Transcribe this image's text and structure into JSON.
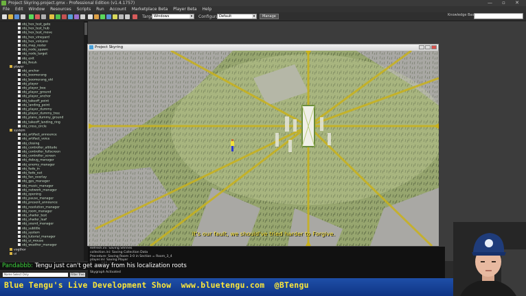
{
  "ide": {
    "title": "Project Skyring.project.gmx  -  Professional Edition (v1.4.1757)",
    "menu": [
      "File",
      "Edit",
      "Window",
      "Resources",
      "Scripts",
      "Run",
      "Account",
      "Marketplace Beta",
      "Player Beta",
      "Help"
    ],
    "toolbar": {
      "target_label": "Target:",
      "target_value": "Windows",
      "configuration_label": "Configuration:",
      "configuration_value": "Default",
      "manage_label": "Manage",
      "knowledge_label": "Knowledge Base:"
    }
  },
  "tree": {
    "items": [
      {
        "label": "obj_hex_test_gate",
        "kind": "item"
      },
      {
        "label": "obj_hex_test_hub",
        "kind": "item"
      },
      {
        "label": "obj_hex_test_move",
        "kind": "item"
      },
      {
        "label": "obj_hex_vineyard",
        "kind": "item"
      },
      {
        "label": "obj_hex_volcano",
        "kind": "item"
      },
      {
        "label": "obj_map_roster",
        "kind": "item"
      },
      {
        "label": "obj_node_spawn",
        "kind": "item"
      },
      {
        "label": "obj_node_target",
        "kind": "item"
      },
      {
        "label": "obj_exit",
        "kind": "item"
      },
      {
        "label": "obj_finish",
        "kind": "item"
      },
      {
        "label": "player",
        "kind": "folder"
      },
      {
        "label": "obj_anchor",
        "kind": "item"
      },
      {
        "label": "obj_boomerang",
        "kind": "item"
      },
      {
        "label": "obj_boomerang_old",
        "kind": "item"
      },
      {
        "label": "obj_player",
        "kind": "item"
      },
      {
        "label": "obj_player_bee",
        "kind": "item"
      },
      {
        "label": "obj_player_ground",
        "kind": "item"
      },
      {
        "label": "obj_player_anchor",
        "kind": "item"
      },
      {
        "label": "obj_takeoff_point",
        "kind": "item"
      },
      {
        "label": "obj_landing_point",
        "kind": "item"
      },
      {
        "label": "obj_player_dummy",
        "kind": "item"
      },
      {
        "label": "obj_player_dummy_tree",
        "kind": "item"
      },
      {
        "label": "obj_plane_dummy_ground",
        "kind": "item"
      },
      {
        "label": "obj_takeoff_landing_ring",
        "kind": "item"
      },
      {
        "label": "obj_cross_circle",
        "kind": "item"
      },
      {
        "label": "system",
        "kind": "folder"
      },
      {
        "label": "obj_artifact_announce",
        "kind": "item"
      },
      {
        "label": "obj_artifact_voice",
        "kind": "item"
      },
      {
        "label": "obj_closing",
        "kind": "item"
      },
      {
        "label": "obj_controller_altitude",
        "kind": "item"
      },
      {
        "label": "obj_controller_fullscreen",
        "kind": "item"
      },
      {
        "label": "obj_controller_screen",
        "kind": "item"
      },
      {
        "label": "obj_debug_manager",
        "kind": "item"
      },
      {
        "label": "obj_enemy_manager",
        "kind": "item"
      },
      {
        "label": "obj_fade_in",
        "kind": "item"
      },
      {
        "label": "obj_fade_out",
        "kind": "item"
      },
      {
        "label": "obj_fan_overlay",
        "kind": "item"
      },
      {
        "label": "obj_gps_manager",
        "kind": "item"
      },
      {
        "label": "obj_music_manager",
        "kind": "item"
      },
      {
        "label": "obj_network_manager",
        "kind": "item"
      },
      {
        "label": "obj_opening",
        "kind": "item"
      },
      {
        "label": "obj_pause_manager",
        "kind": "item"
      },
      {
        "label": "obj_present_announce",
        "kind": "item"
      },
      {
        "label": "obj_resolution_manager",
        "kind": "item"
      },
      {
        "label": "obj_room_manager",
        "kind": "item"
      },
      {
        "label": "obj_shader_test",
        "kind": "item"
      },
      {
        "label": "obj_shader_leaf",
        "kind": "item"
      },
      {
        "label": "obj_sound_manager",
        "kind": "item"
      },
      {
        "label": "obj_subtitle",
        "kind": "item"
      },
      {
        "label": "obj_system",
        "kind": "item"
      },
      {
        "label": "obj_tutorial_manager",
        "kind": "item"
      },
      {
        "label": "obj_ui_mouse",
        "kind": "item"
      },
      {
        "label": "obj_weather_manager",
        "kind": "item"
      },
      {
        "label": "vogthor",
        "kind": "folder"
      },
      {
        "label": "ui",
        "kind": "folder"
      }
    ],
    "filter_placeholder": "Name Select Only",
    "filter_button": "Filter Tree"
  },
  "game": {
    "window_title": "Project Skyring",
    "subtitle": "It's our fault, we should've tried harder to Forgive.",
    "grass_color": "#97a66f",
    "path_color": "#a9a8a4",
    "beam_color": "#c9b21c"
  },
  "console": {
    "lines": [
      "Refresh.ini: Saving Shrines",
      "collection.ini: Saving Collection Data",
      "Procedure: Saving Room 3-0 in Section = Room_3_4",
      "player.ini: Saving Player",
      "Saves: 123 tiles",
      "Saved: 0 tags/names",
      "Skygraph Activated"
    ]
  },
  "ticker": {
    "user": "Pandabbb:",
    "message": " Tengu just can't get away from his localization roots"
  },
  "stream": {
    "banner": "Blue Tengu's Live Development Show  www.bluetengu.com  @BTengu",
    "banner_color": "#ffe93a",
    "banner_bg": "#1a47a0"
  }
}
